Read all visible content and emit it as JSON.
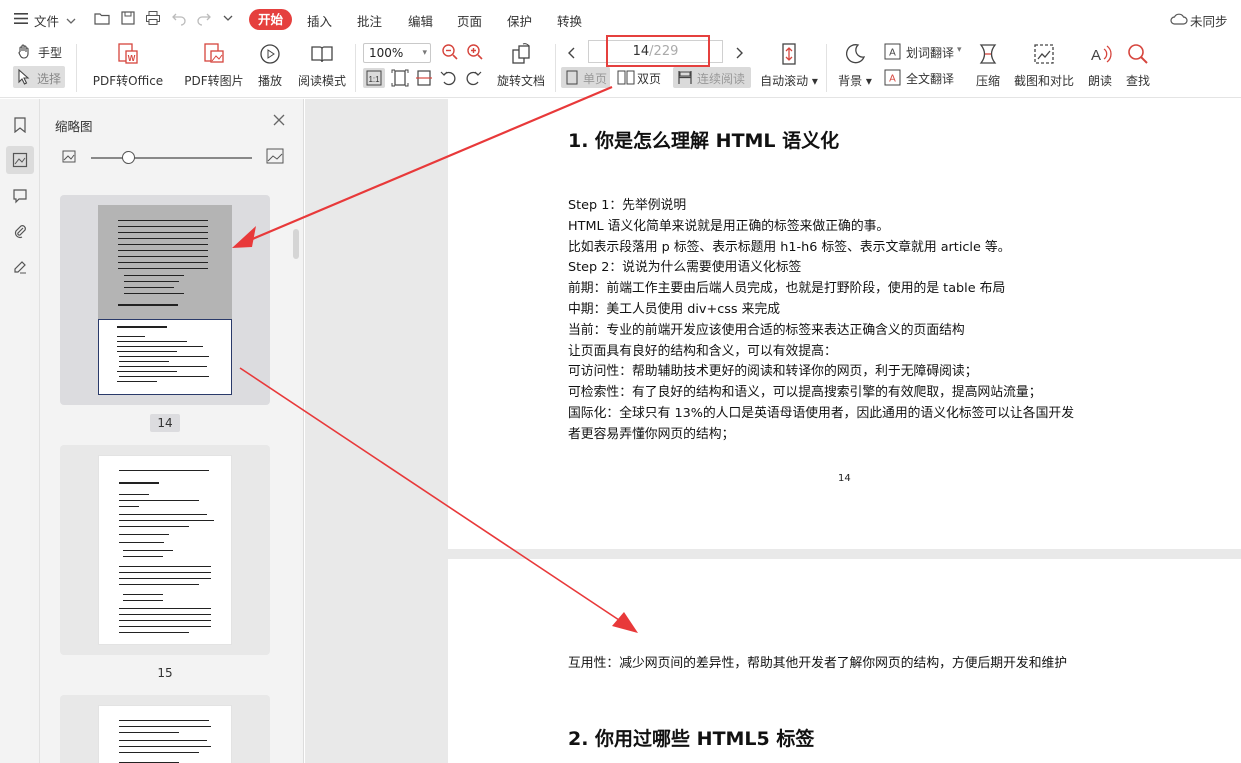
{
  "menu": {
    "file_label": "文件",
    "tabs": [
      "开始",
      "插入",
      "批注",
      "编辑",
      "页面",
      "保护",
      "转换"
    ],
    "sync_label": "未同步"
  },
  "toolbar": {
    "hand": "手型",
    "select": "选择",
    "pdf_to_office": "PDF转Office",
    "pdf_to_image": "PDF转图片",
    "play": "播放",
    "read_mode": "阅读模式",
    "zoom": "100%",
    "rotate_doc": "旋转文档",
    "page_current": "14",
    "page_total": "/229",
    "single_page": "单页",
    "double_page": "双页",
    "continuous": "连续阅读",
    "auto_scroll": "自动滚动",
    "background": "背景",
    "word_translate": "划词翻译",
    "full_translate": "全文翻译",
    "compress": "压缩",
    "screenshot_compare": "截图和对比",
    "read_aloud": "朗读",
    "find": "查找"
  },
  "thumbnails": {
    "title": "缩略图",
    "pages": [
      "14",
      "15"
    ]
  },
  "document": {
    "heading1": "1.  你是怎么理解 HTML 语义化",
    "lines": [
      "Step 1：先举例说明",
      "HTML 语义化简单来说就是用正确的标签来做正确的事。",
      "比如表示段落用  p 标签、表示标题用  h1-h6 标签、表示文章就用  article 等。",
      "Step 2：说说为什么需要使用语义化标签",
      "    前期：前端工作主要由后端人员完成，也就是打野阶段，使用的是 table 布局",
      "    中期：美工人员使用 div+css 来完成",
      "    当前：专业的前端开发应该使用合适的标签来表达正确含义的页面结构",
      "让页面具有良好的结构和含义，可以有效提高：",
      "    可访问性：帮助辅助技术更好的阅读和转译你的网页，利于无障碍阅读；",
      "    可检索性：有了良好的结构和语义，可以提高搜索引擎的有效爬取，提高网站流量；",
      "    国际化：全球只有 13%的人口是英语母语使用者，因此通用的语义化标签可以让各国开发",
      "者更容易弄懂你网页的结构；"
    ],
    "page_number": "14",
    "page2_line": "    互用性：减少网页间的差异性，帮助其他开发者了解你网页的结构，方便后期开发和维护",
    "heading2": "2.  你用过哪些 HTML5 标签"
  },
  "colors": {
    "accent": "#e5403e",
    "annotation_red": "#e8393a"
  }
}
